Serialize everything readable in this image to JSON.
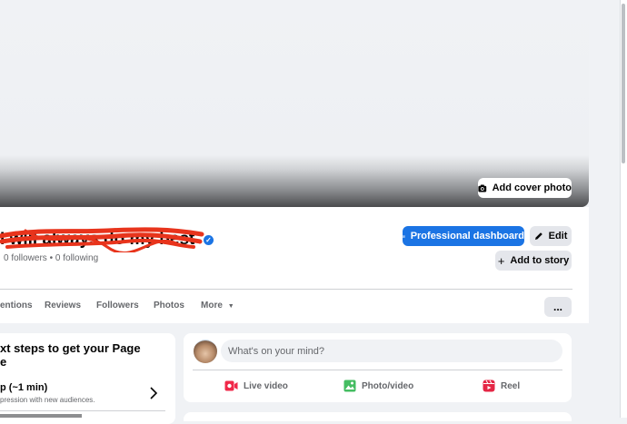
{
  "cover": {
    "add_cover_label": "Add cover photo"
  },
  "profile": {
    "name": "I will always do my best",
    "followers_count": "0 followers",
    "separator": "•",
    "following_count": "0 following"
  },
  "actions": {
    "dashboard_label": "Professional dashboard",
    "edit_label": "Edit",
    "story_label": "Add to story",
    "more_label": "..."
  },
  "tabs": [
    {
      "label": "entions"
    },
    {
      "label": "Reviews"
    },
    {
      "label": "Followers"
    },
    {
      "label": "Photos"
    },
    {
      "label": "More"
    }
  ],
  "left_card": {
    "title_line1": "xt steps to get your Page",
    "title_line2": "e",
    "setup_title": "p (~1 min)",
    "setup_desc": "pression with new audiences."
  },
  "composer": {
    "placeholder": "What's on your mind?",
    "live_label": "Live video",
    "photo_label": "Photo/video",
    "reel_label": "Reel"
  },
  "colors": {
    "accent": "#1b74e4",
    "live": "#f02849",
    "photo": "#45bd62",
    "reel": "#e42645",
    "scribble": "#e8341c"
  }
}
